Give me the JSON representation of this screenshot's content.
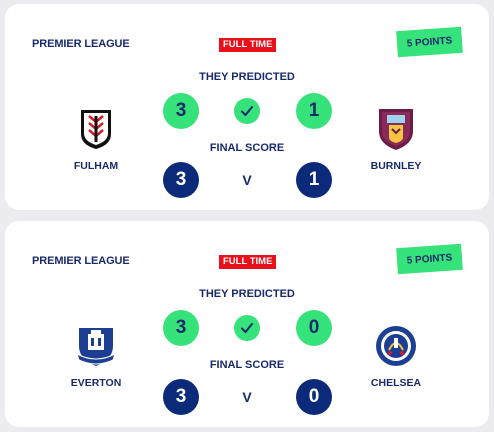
{
  "matches": [
    {
      "league": "PREMIER LEAGUE",
      "status": "FULL TIME",
      "points": "5 POINTS",
      "predicted_label": "THEY PREDICTED",
      "final_label": "FINAL SCORE",
      "home": {
        "name": "FULHAM",
        "crest_icon": "fulham-crest-icon"
      },
      "away": {
        "name": "BURNLEY",
        "crest_icon": "burnley-crest-icon"
      },
      "predicted": {
        "home": "3",
        "away": "1"
      },
      "final": {
        "home": "3",
        "away": "1"
      },
      "vs": "V"
    },
    {
      "league": "PREMIER LEAGUE",
      "status": "FULL TIME",
      "points": "5 POINTS",
      "predicted_label": "THEY PREDICTED",
      "final_label": "FINAL SCORE",
      "home": {
        "name": "EVERTON",
        "crest_icon": "everton-crest-icon"
      },
      "away": {
        "name": "CHELSEA",
        "crest_icon": "chelsea-crest-icon"
      },
      "predicted": {
        "home": "3",
        "away": "0"
      },
      "final": {
        "home": "3",
        "away": "0"
      },
      "vs": "V"
    }
  ],
  "colors": {
    "navy": "#0c2a7a",
    "green": "#36e27a",
    "red": "#e8101a",
    "text": "#1a2a6b"
  }
}
